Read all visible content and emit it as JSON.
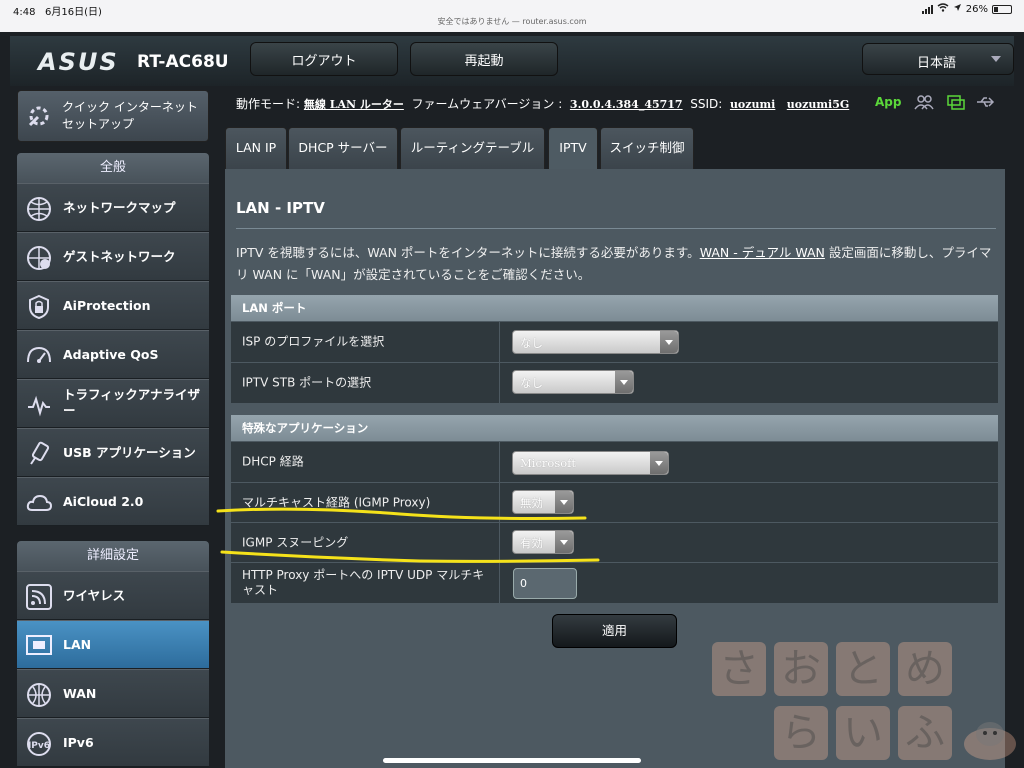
{
  "statusbar": {
    "time": "4:48",
    "date": "6月16日(日)",
    "url": "安全ではありません — router.asus.com",
    "battery": "26%"
  },
  "header": {
    "brand": "ASUS",
    "model": "RT-AC68U",
    "logout": "ログアウト",
    "reboot": "再起動",
    "language": "日本語"
  },
  "sidebar": {
    "quick_setup": [
      "クイック インターネット",
      "セットアップ"
    ],
    "general_label": "全般",
    "general_items": [
      {
        "label": "ネットワークマップ",
        "icon": "network-map-icon"
      },
      {
        "label": "ゲストネットワーク",
        "icon": "guest-network-icon"
      },
      {
        "label": "AiProtection",
        "icon": "aiprotection-icon"
      },
      {
        "label": "Adaptive QoS",
        "icon": "qos-icon"
      },
      {
        "label": "トラフィックアナライザー",
        "icon": "traffic-analyzer-icon"
      },
      {
        "label": "USB アプリケーション",
        "icon": "usb-app-icon"
      },
      {
        "label": "AiCloud 2.0",
        "icon": "aicloud-icon"
      }
    ],
    "advanced_label": "詳細設定",
    "advanced_items": [
      {
        "label": "ワイヤレス",
        "icon": "wireless-icon"
      },
      {
        "label": "LAN",
        "icon": "lan-icon",
        "active": true
      },
      {
        "label": "WAN",
        "icon": "wan-icon"
      },
      {
        "label": "IPv6",
        "icon": "ipv6-icon"
      }
    ]
  },
  "infobar": {
    "mode_label": "動作モード:",
    "mode_value": "無線 LAN ルーター",
    "fw_label": "ファームウェアバージョン :",
    "fw_value": "3.0.0.4.384_45717",
    "ssid_label": "SSID:",
    "ssid_1": "uozumi",
    "ssid_2": "uozumi5G",
    "app_label": "App"
  },
  "tabs": [
    "LAN IP",
    "DHCP サーバー",
    "ルーティングテーブル",
    "IPTV",
    "スイッチ制御"
  ],
  "active_tab": "IPTV",
  "main": {
    "title": "LAN - IPTV",
    "description_part1": "IPTV を視聴するには、WAN ポートをインターネットに接続する必要があります。",
    "description_link": "WAN - デュアル WAN",
    "description_part2": " 設定画面に移動し、プライマリ WAN に「WAN」が設定されていることをご確認ください。",
    "lan_port_header": "LAN ポート",
    "isp_profile_label": "ISP のプロファイルを選択",
    "isp_profile_value": "なし",
    "stb_port_label": "IPTV STB ポートの選択",
    "stb_port_value": "なし",
    "special_header": "特殊なアプリケーション",
    "dhcp_route_label": "DHCP 経路",
    "dhcp_route_value": "Microsoft",
    "igmp_proxy_label": "マルチキャスト経路 (IGMP Proxy)",
    "igmp_proxy_value": "無効",
    "igmp_snooping_label": "IGMP スヌーピング",
    "igmp_snooping_value": "有効",
    "udp_proxy_label": "HTTP Proxy ポートへの IPTV UDP マルチキャスト",
    "udp_proxy_value": "0",
    "apply": "適用"
  },
  "watermark": [
    "さ",
    "お",
    "と",
    "め",
    "ら",
    "い",
    "ふ"
  ],
  "colors": {
    "accent_active": "#3a7fb2",
    "app_green": "#5bd83a",
    "highlight_yellow": "#f5e21a"
  }
}
